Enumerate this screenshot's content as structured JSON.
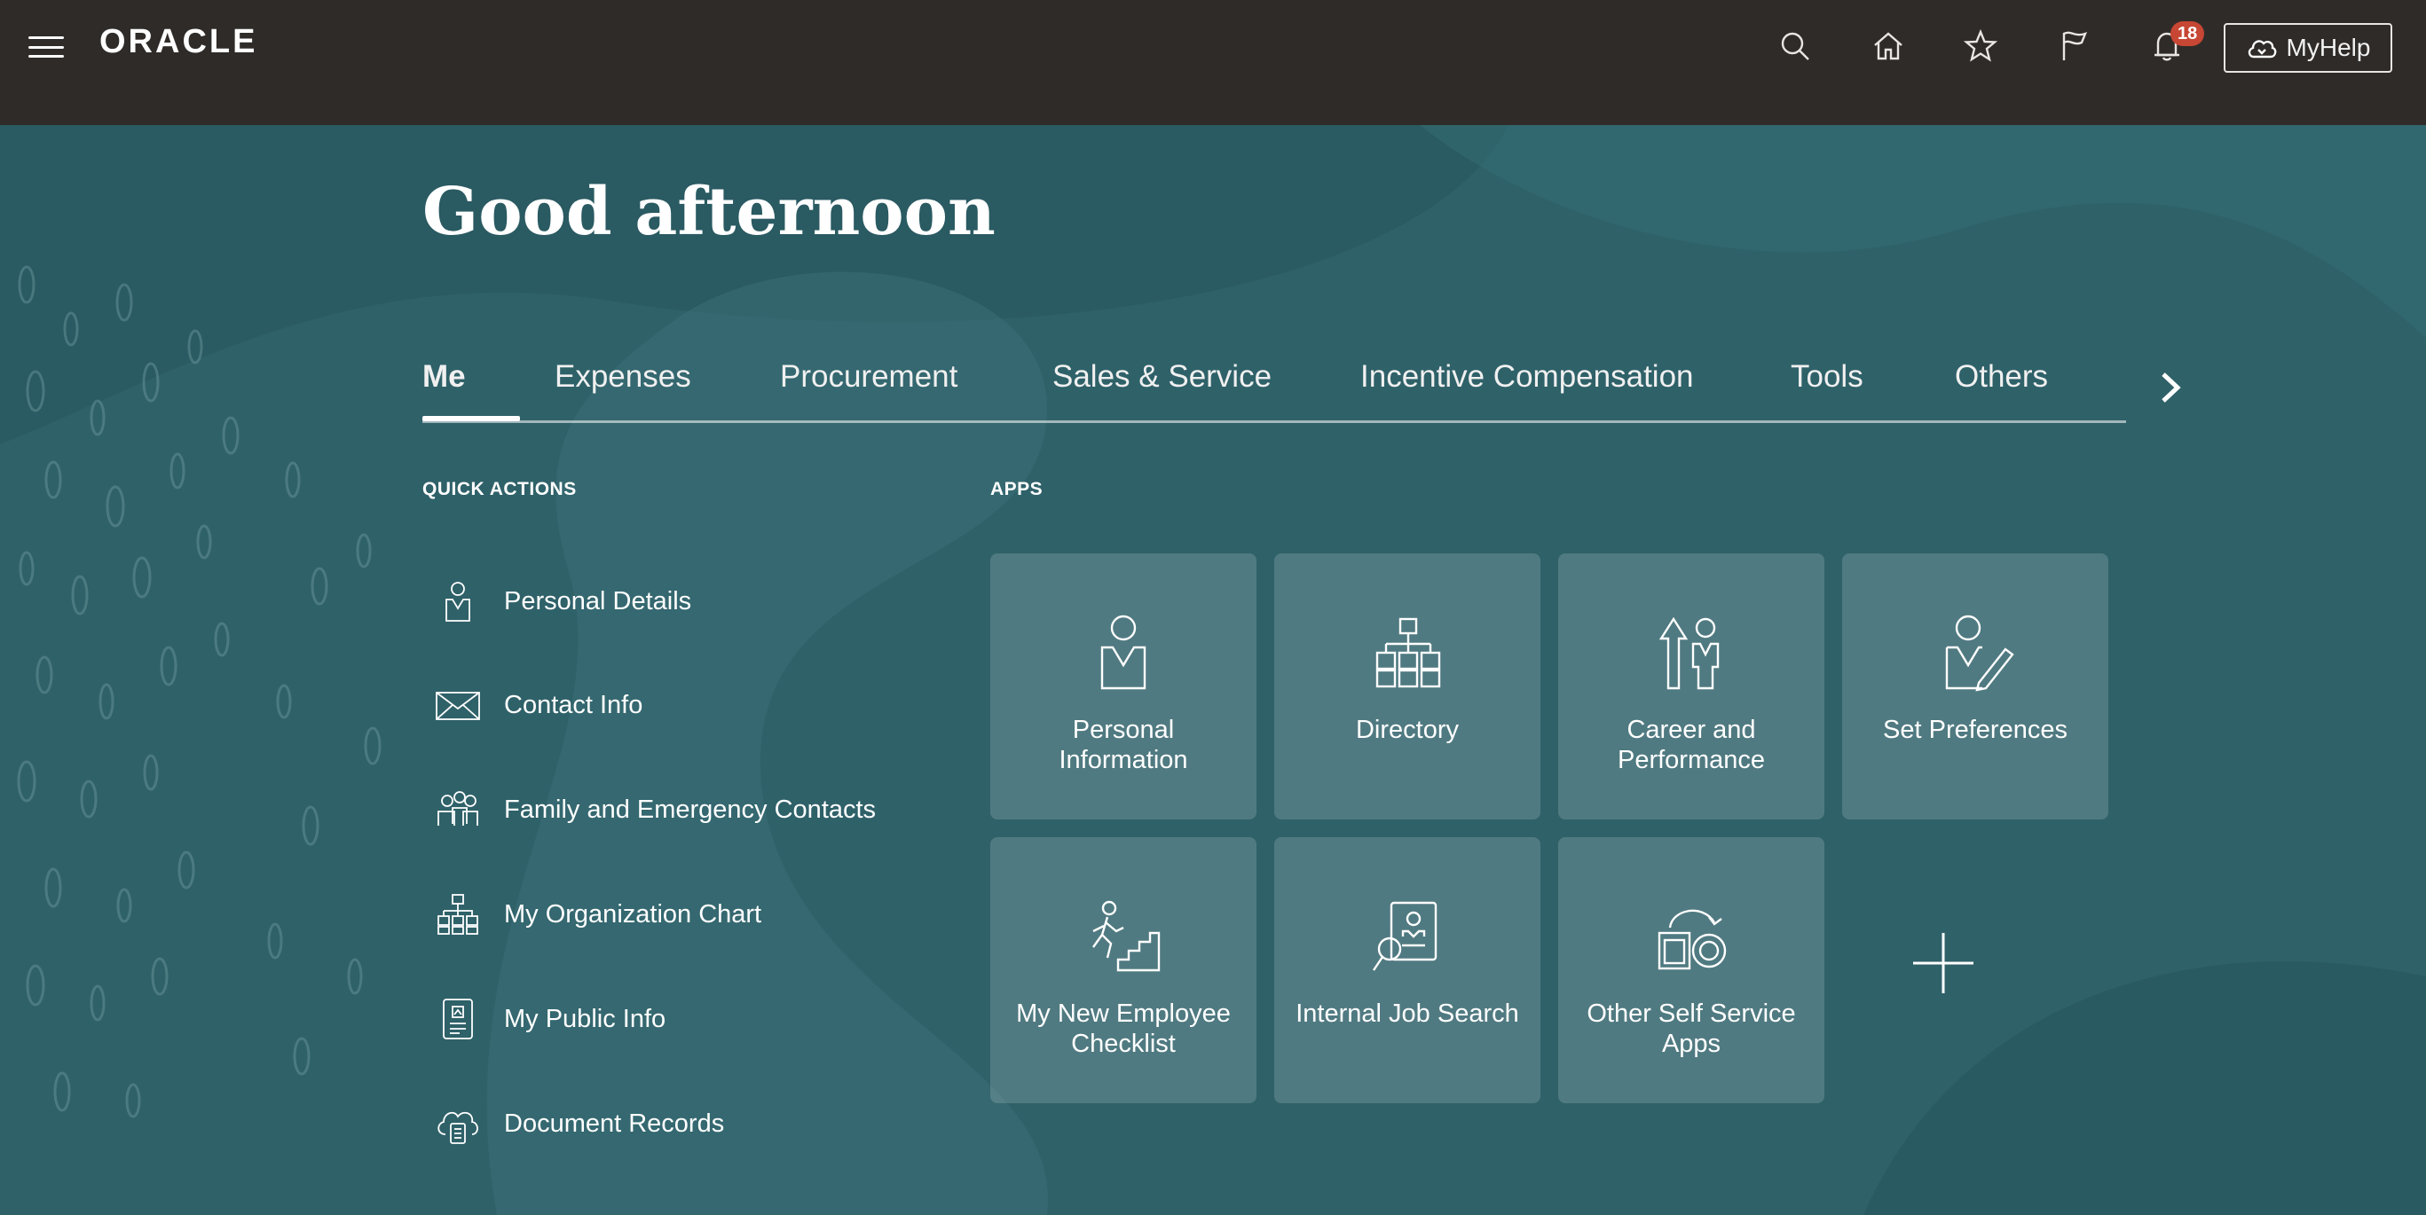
{
  "header": {
    "logo": "ORACLE",
    "icons": [
      "menu-icon",
      "search-icon",
      "home-icon",
      "star-icon",
      "flag-icon",
      "bell-icon"
    ],
    "notification_count": "18",
    "myhelp_label": "MyHelp"
  },
  "greeting": "Good afternoon",
  "tabs": [
    {
      "label": "Me",
      "active": true
    },
    {
      "label": "Expenses"
    },
    {
      "label": "Procurement"
    },
    {
      "label": "Sales & Service"
    },
    {
      "label": "Incentive Compensation"
    },
    {
      "label": "Tools"
    },
    {
      "label": "Others"
    }
  ],
  "quick_actions": {
    "title": "QUICK ACTIONS",
    "items": [
      {
        "label": "Personal Details",
        "icon": "person-badge-icon"
      },
      {
        "label": "Contact Info",
        "icon": "envelope-icon"
      },
      {
        "label": "Family and Emergency Contacts",
        "icon": "family-icon"
      },
      {
        "label": "My Organization Chart",
        "icon": "org-chart-icon"
      },
      {
        "label": "My Public Info",
        "icon": "id-card-icon"
      },
      {
        "label": "Document Records",
        "icon": "cloud-document-icon"
      }
    ]
  },
  "apps": {
    "title": "APPS",
    "tiles": [
      {
        "label": "Personal Information",
        "icon": "person-icon"
      },
      {
        "label": "Directory",
        "icon": "hierarchy-icon"
      },
      {
        "label": "Career and Performance",
        "icon": "career-growth-icon"
      },
      {
        "label": "Set Preferences",
        "icon": "person-pencil-icon"
      },
      {
        "label": "My New Employee Checklist",
        "icon": "climbing-stairs-icon"
      },
      {
        "label": "Internal Job Search",
        "icon": "job-search-icon"
      },
      {
        "label": "Other Self Service Apps",
        "icon": "apps-cycle-icon"
      }
    ],
    "add_icon": "plus-icon"
  }
}
